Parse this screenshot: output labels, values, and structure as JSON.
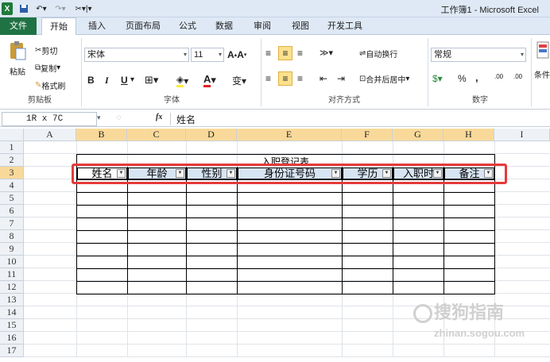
{
  "titlebar": {
    "title": "工作簿1 - Microsoft Excel",
    "icon": "X"
  },
  "tabs": [
    "文件",
    "开始",
    "插入",
    "页面布局",
    "公式",
    "数据",
    "审阅",
    "视图",
    "开发工具"
  ],
  "ribbon": {
    "clipboard": {
      "paste": "粘贴",
      "cut": "剪切",
      "copy": "复制",
      "format_painter": "格式刷",
      "group": "剪贴板"
    },
    "font": {
      "name": "宋体",
      "size": "11",
      "bold": "B",
      "italic": "I",
      "underline": "U",
      "group": "字体"
    },
    "alignment": {
      "wrap": "自动换行",
      "merge": "合并后居中",
      "group": "对齐方式"
    },
    "number": {
      "format": "常规",
      "percent": "%",
      "comma": ",",
      "inc_decimal": ".00",
      "group": "数字"
    },
    "cond": "条件"
  },
  "formula_bar": {
    "name_box": "1R x 7C",
    "fx": "fx",
    "value": "姓名"
  },
  "grid": {
    "columns": [
      "A",
      "B",
      "C",
      "D",
      "E",
      "F",
      "G",
      "H",
      "I"
    ],
    "rows": [
      "1",
      "2",
      "3",
      "4",
      "5",
      "6",
      "7",
      "8",
      "9",
      "10",
      "11",
      "12",
      "13",
      "14",
      "15",
      "16",
      "17"
    ],
    "title": "入职登记表",
    "headers": [
      "姓名",
      "年龄",
      "性别",
      "身份证号码",
      "学历",
      "入职时",
      "备注"
    ]
  },
  "watermark": {
    "text": "搜狗指南",
    "sub": "zhinan.sogou.com"
  },
  "colors": {
    "ribbon_bg": "#dfe9f5",
    "file_tab": "#1f7244",
    "header_fill": "#d7e4f3",
    "highlight_box": "#e63a3a",
    "selected_header": "#f9d99a"
  }
}
